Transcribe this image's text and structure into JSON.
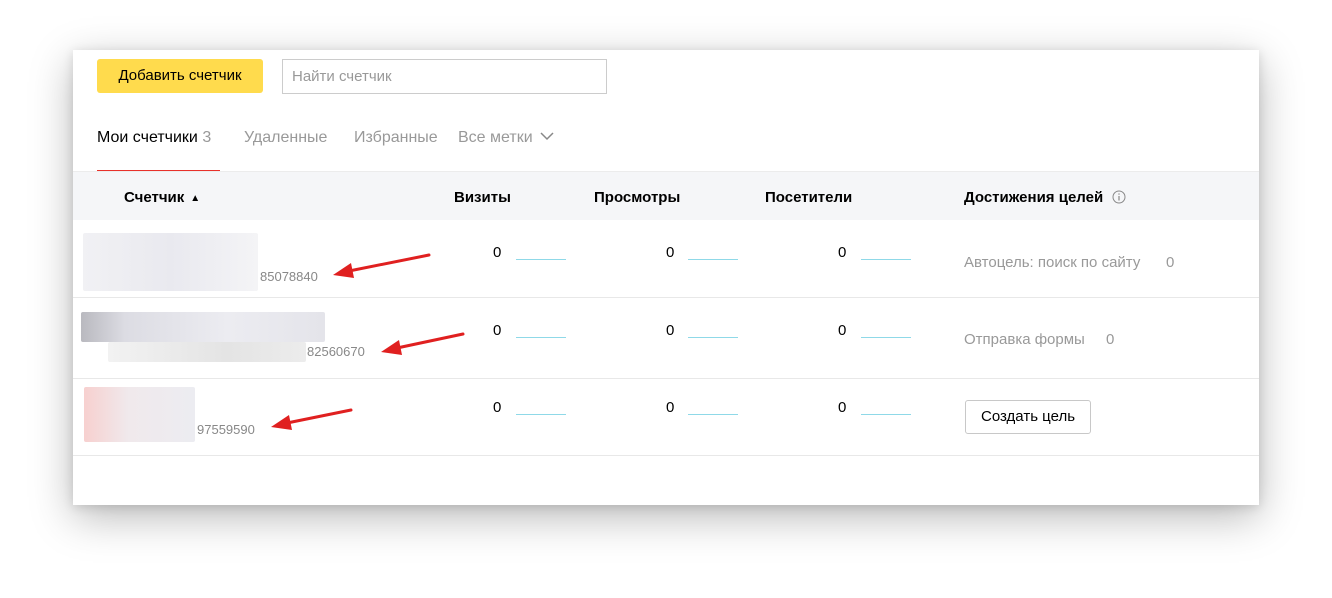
{
  "toolbar": {
    "add_label": "Добавить счетчик",
    "search_placeholder": "Найти счетчик"
  },
  "tabs": [
    {
      "label": "Мои счетчики",
      "count": "3",
      "active": true
    },
    {
      "label": "Удаленные"
    },
    {
      "label": "Избранные"
    },
    {
      "label": "Все метки"
    }
  ],
  "table": {
    "columns": [
      "Счетчик",
      "Визиты",
      "Просмотры",
      "Посетители",
      "Достижения целей"
    ],
    "sort_indicator": "▲",
    "rows": [
      {
        "counter_id": "85078840",
        "visits": "0",
        "views": "0",
        "visitors": "0",
        "goal_label": "Автоцель: поиск по сайту",
        "goal_count": "0"
      },
      {
        "counter_id": "82560670",
        "visits": "0",
        "views": "0",
        "visitors": "0",
        "goal_label": "Отправка формы",
        "goal_count": "0"
      },
      {
        "counter_id": "97559590",
        "visits": "0",
        "views": "0",
        "visitors": "0",
        "goal_button": "Создать цель"
      }
    ]
  },
  "colors": {
    "accent": "#ffdb4d",
    "tab_underline": "#e8312b",
    "annotation_arrow": "#e02020",
    "sparkline": "#8fd9e8"
  }
}
